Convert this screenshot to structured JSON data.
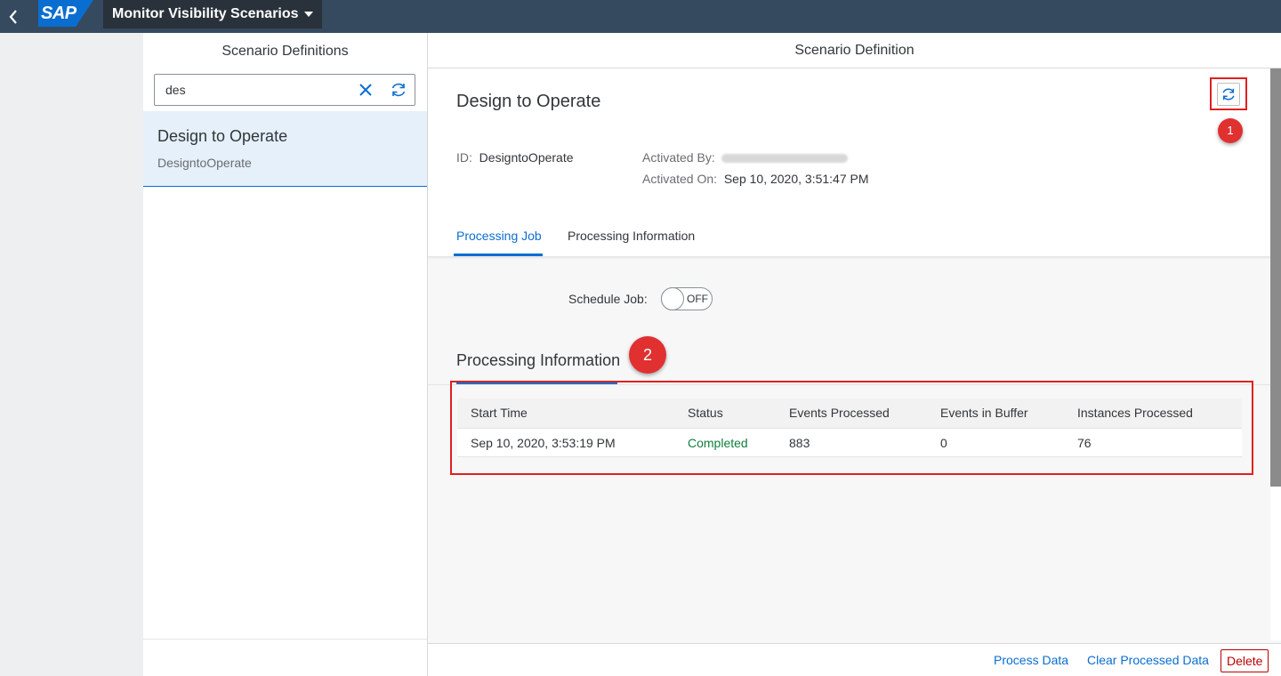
{
  "shell": {
    "brand": "SAP",
    "title": "Monitor Visibility Scenarios"
  },
  "master": {
    "title": "Scenario Definitions",
    "search_value": "des",
    "items": [
      {
        "title": "Design to Operate",
        "subtitle": "DesigntoOperate"
      }
    ]
  },
  "detail": {
    "header_title": "Scenario Definition",
    "object_title": "Design to Operate",
    "id_label": "ID:",
    "id_value": "DesigntoOperate",
    "activated_by_label": "Activated By:",
    "activated_on_label": "Activated On:",
    "activated_on_value": "Sep 10, 2020, 3:51:47 PM",
    "tabs": [
      "Processing Job",
      "Processing Information"
    ],
    "schedule_label": "Schedule Job:",
    "schedule_state": "OFF",
    "section_title": "Processing Information",
    "table": {
      "columns": [
        "Start Time",
        "Status",
        "Events Processed",
        "Events in Buffer",
        "Instances Processed"
      ],
      "rows": [
        [
          "Sep 10, 2020, 3:53:19 PM",
          "Completed",
          "883",
          "0",
          "76"
        ]
      ]
    },
    "footer": {
      "process": "Process Data",
      "clear": "Clear Processed Data",
      "delete": "Delete"
    }
  },
  "annotations": {
    "badge1": "1",
    "badge2": "2"
  },
  "colors": {
    "accent": "#0a6ed1",
    "shell": "#354a5f",
    "highlight": "#e02020",
    "success": "#107e3e"
  }
}
